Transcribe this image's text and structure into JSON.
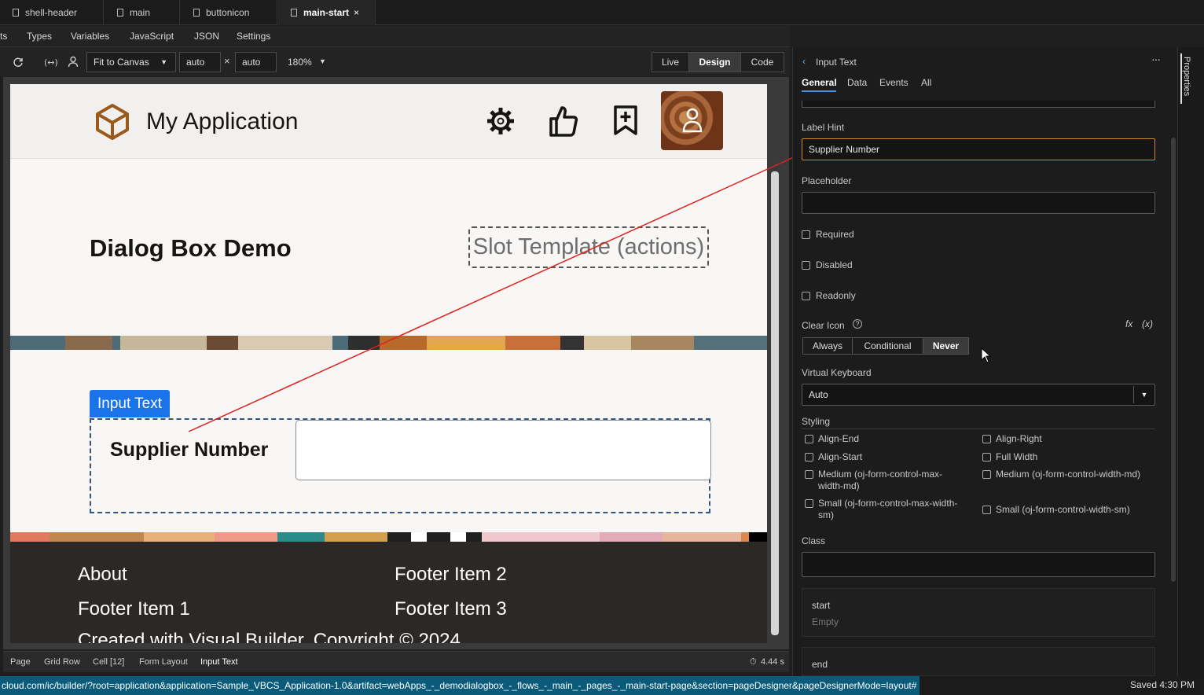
{
  "tabs": [
    {
      "label": "shell-header"
    },
    {
      "label": "main"
    },
    {
      "label": "buttonicon"
    },
    {
      "label": "main-start",
      "close": "×"
    }
  ],
  "menu": [
    "ts",
    "Types",
    "Variables",
    "JavaScript",
    "JSON",
    "Settings"
  ],
  "toolbar": {
    "fit": "Fit to Canvas",
    "width": "auto",
    "times": "×",
    "height": "auto",
    "zoom": "180%",
    "modes": [
      "Live",
      "Design",
      "Code"
    ]
  },
  "canvas": {
    "app_title": "My Application",
    "page_heading": "Dialog Box Demo",
    "slot_label": "Slot Template (actions)",
    "component_badge": "Input Text",
    "field_label": "Supplier Number",
    "footer": {
      "col1": [
        "About",
        "Footer Item 1"
      ],
      "col2": [
        "Footer Item 2",
        "Footer Item 3"
      ],
      "copyright": "Created with Visual Builder, Copyright © 2024"
    }
  },
  "breadcrumbs": [
    "Page",
    "Grid Row",
    "Cell [12]",
    "Form Layout",
    "Input Text"
  ],
  "timer": "4.44 s",
  "url": "cloud.com/ic/builder/?root=application&application=Sample_VBCS_Application-1.0&artifact=webApps_-_demodialogbox_-_flows_-_main_-_pages_-_main-start-page&section=pageDesigner&pageDesignerMode=layout#",
  "saved": "Saved 4:30 PM",
  "properties": {
    "rail_label": "Properties",
    "title": "Input Text",
    "more": "···",
    "tabs": [
      "General",
      "Data",
      "Events",
      "All"
    ],
    "label_hint_label": "Label Hint",
    "label_hint_value": "Supplier Number",
    "placeholder_label": "Placeholder",
    "placeholder_value": "",
    "required": "Required",
    "disabled": "Disabled",
    "readonly": "Readonly",
    "clear_icon_label": "Clear Icon",
    "clear_icon_options": [
      "Always",
      "Conditional",
      "Never"
    ],
    "clear_icon_selected": "Never",
    "fx": "fx",
    "var": "(x)",
    "virtual_keyboard_label": "Virtual Keyboard",
    "virtual_keyboard_value": "Auto",
    "styling_label": "Styling",
    "styling_options": [
      "Align-End",
      "Align-Right",
      "Align-Start",
      "Full Width",
      "Medium (oj-form-control-max-width-md)",
      "Medium (oj-form-control-width-md)",
      "Small (oj-form-control-max-width-sm)",
      "Small (oj-form-control-width-sm)"
    ],
    "class_label": "Class",
    "class_value": "",
    "start_slot": "start",
    "start_slot_value": "Empty",
    "end_slot": "end"
  },
  "colors": {
    "accent_blue": "#1a73e8",
    "arrow_red": "#e0201c",
    "focus_orange": "#d08a2a",
    "url_bar": "#0a5a7a"
  }
}
